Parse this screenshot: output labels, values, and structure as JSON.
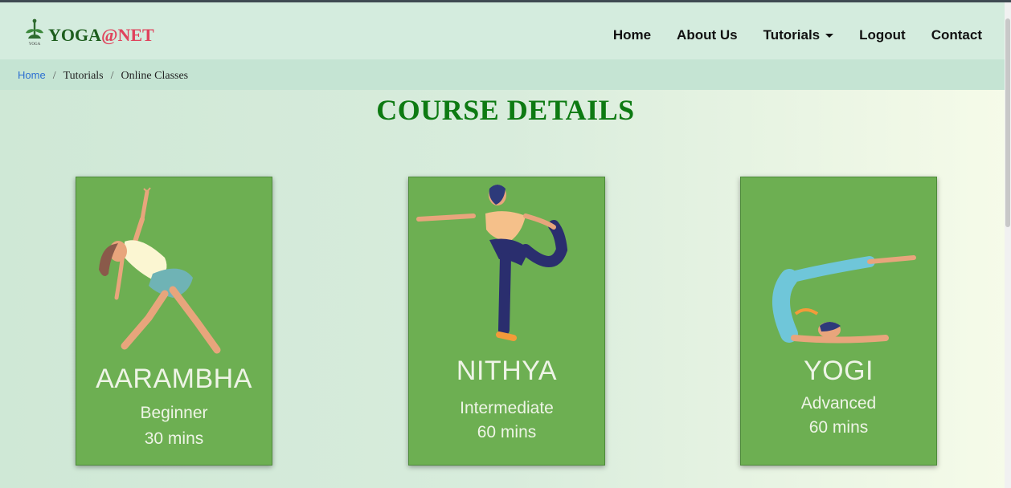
{
  "brand": {
    "name_prefix": "YOGA",
    "name_suffix": "@NET",
    "logo_caption": "YOGA"
  },
  "nav": {
    "home": "Home",
    "about": "About Us",
    "tutorials": "Tutorials",
    "logout": "Logout",
    "contact": "Contact"
  },
  "breadcrumb": [
    "Home",
    "Tutorials",
    "Online Classes"
  ],
  "page_title": "COURSE DETAILS",
  "courses": [
    {
      "name": "AARAMBHA",
      "level": "Beginner",
      "duration": "30 mins"
    },
    {
      "name": "NITHYA",
      "level": "Intermediate",
      "duration": "60 mins"
    },
    {
      "name": "YOGI",
      "level": "Advanced",
      "duration": "60 mins"
    }
  ],
  "colors": {
    "card_bg": "#6daf52",
    "title": "#0d7a12",
    "brand_accent": "#e0435c",
    "breadcrumb_link": "#2c6fd1"
  }
}
